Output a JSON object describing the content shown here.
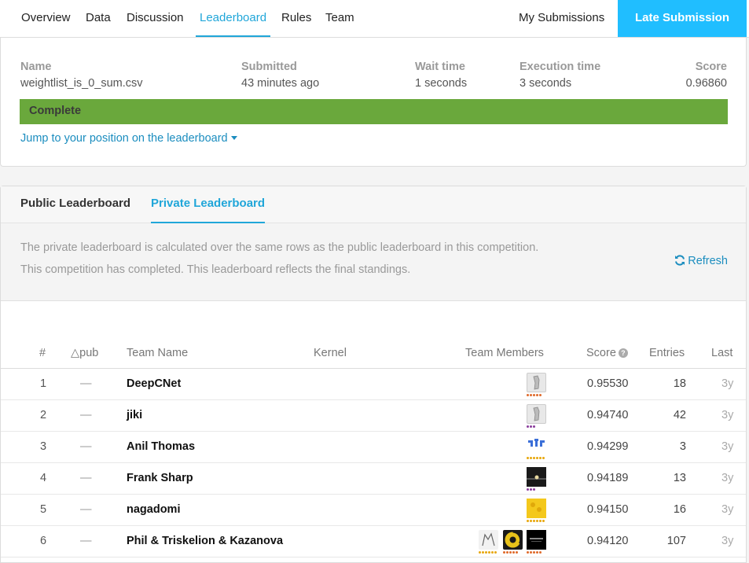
{
  "nav": {
    "tabs": [
      "Overview",
      "Data",
      "Discussion",
      "Leaderboard",
      "Rules",
      "Team"
    ],
    "my_submissions": "My Submissions",
    "late_submission": "Late Submission"
  },
  "submission": {
    "name_label": "Name",
    "name_value": "weightlist_is_0_sum.csv",
    "submitted_label": "Submitted",
    "submitted_value": "43 minutes ago",
    "wait_label": "Wait time",
    "wait_value": "1 seconds",
    "exec_label": "Execution time",
    "exec_value": "3 seconds",
    "score_label": "Score",
    "score_value": "0.96860",
    "status": "Complete",
    "jump_link": "Jump to your position on the leaderboard"
  },
  "leaderboard": {
    "tabs": [
      "Public Leaderboard",
      "Private Leaderboard"
    ],
    "info_line1": "The private leaderboard is calculated over the same rows as the public leaderboard in this competition.",
    "info_line2": "This competition has completed. This leaderboard reflects the final standings.",
    "refresh": "Refresh",
    "columns": {
      "rank": "#",
      "pub": "△pub",
      "team": "Team Name",
      "kernel": "Kernel",
      "members": "Team Members",
      "score": "Score",
      "entries": "Entries",
      "last": "Last"
    },
    "rows": [
      {
        "rank": "1",
        "delta": "—",
        "team": "DeepCNet",
        "score": "0.95530",
        "entries": "18",
        "last": "3y"
      },
      {
        "rank": "2",
        "delta": "—",
        "team": "jiki",
        "score": "0.94740",
        "entries": "42",
        "last": "3y"
      },
      {
        "rank": "3",
        "delta": "—",
        "team": "Anil Thomas",
        "score": "0.94299",
        "entries": "3",
        "last": "3y"
      },
      {
        "rank": "4",
        "delta": "—",
        "team": "Frank Sharp",
        "score": "0.94189",
        "entries": "13",
        "last": "3y"
      },
      {
        "rank": "5",
        "delta": "—",
        "team": "nagadomi",
        "score": "0.94150",
        "entries": "16",
        "last": "3y"
      },
      {
        "rank": "6",
        "delta": "—",
        "team": "Phil & Triskelion & Kazanova",
        "score": "0.94120",
        "entries": "107",
        "last": "3y"
      }
    ]
  },
  "colors": {
    "accent": "#20beff",
    "complete": "#6aa83c",
    "link": "#1b8dbf"
  }
}
